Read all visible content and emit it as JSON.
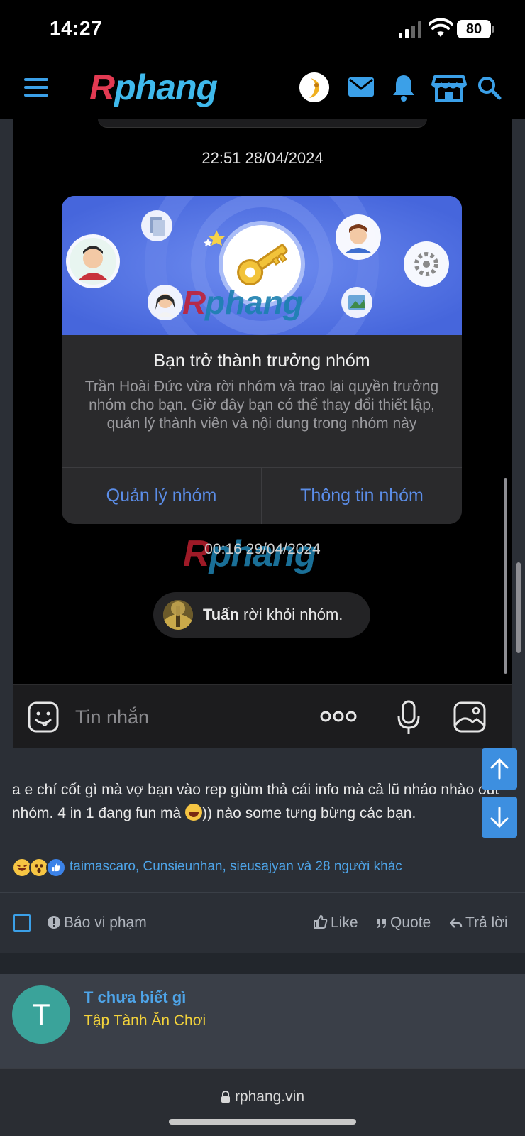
{
  "status_bar": {
    "time": "14:27",
    "battery": "80"
  },
  "header": {
    "logo_r": "R",
    "logo_rest": "phang"
  },
  "chat": {
    "timestamp_1": "22:51 28/04/2024",
    "card": {
      "title": "Bạn trở thành trưởng nhóm",
      "description": "Trần Hoài Đức vừa rời nhóm và trao lại quyền trưởng nhóm cho bạn. Giờ đây bạn có thể thay đổi thiết lập, quản lý thành viên và nội dung trong nhóm này",
      "button_left": "Quản lý nhóm",
      "button_right": "Thông tin nhóm"
    },
    "watermark_r": "R",
    "watermark_rest": "phang",
    "timestamp_2": "00:16 29/04/2024",
    "left_notice_name": "Tuấn",
    "left_notice_text": " rời khỏi nhóm.",
    "composer_placeholder": "Tin nhắn"
  },
  "post": {
    "text_before_emoji": "a e chí cốt gì mà vợ bạn vào rep giùm thả cái info mà cả lũ nháo nhào out nhóm. 4 in 1 đang fun mà ",
    "text_after_emoji": ")) nào some tưng bừng các bạn.",
    "reactors": "taimascaro, Cunsieunhan, sieusajyan và 28 người khác",
    "actions": {
      "report": "Báo vi phạm",
      "like": "Like",
      "quote": "Quote",
      "reply": "Trả lời"
    }
  },
  "next_post": {
    "avatar_letter": "T",
    "username": "T chưa biết gì",
    "user_title": "Tập Tành Ăn Chơi"
  },
  "browser": {
    "url": "rphang.vin"
  },
  "colors": {
    "accent": "#3ba0e8",
    "link": "#4ea4e8",
    "card_button": "#5b8de8",
    "user_title": "#f2d23b"
  }
}
